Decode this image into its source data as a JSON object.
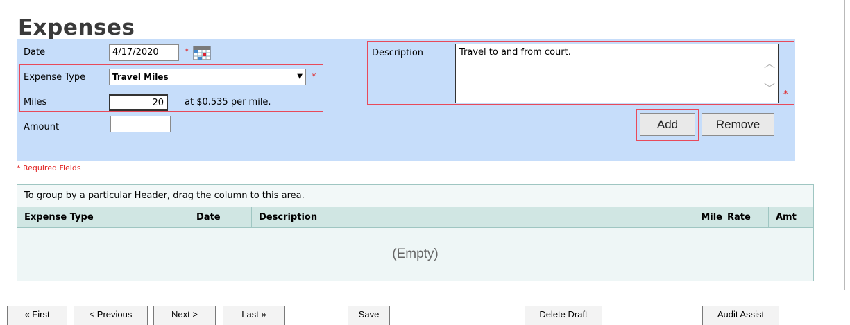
{
  "page": {
    "title": "Expenses"
  },
  "form": {
    "date_label": "Date",
    "date_value": "4/17/2020",
    "required_mark": "*",
    "expense_type_label": "Expense Type",
    "expense_type_value": "Travel Miles",
    "miles_label": "Miles",
    "miles_value": "20",
    "miles_rate_text": "at $0.535 per mile.",
    "amount_label": "Amount",
    "amount_value": "",
    "description_label": "Description",
    "description_value": "Travel to and from court.",
    "add_label": "Add",
    "remove_label": "Remove",
    "required_fields_note": "* Required Fields"
  },
  "grid": {
    "group_hint": "To group by a particular Header, drag the column to this area.",
    "columns": [
      "Expense Type",
      "Date",
      "Description",
      "Mile",
      "Rate",
      "Amt"
    ],
    "empty_text": "(Empty)"
  },
  "nav": {
    "first": "« First",
    "previous": "< Previous",
    "next": "Next >",
    "last": "Last »",
    "save": "Save",
    "delete_draft": "Delete Draft",
    "audit_assist": "Audit Assist"
  },
  "colors": {
    "panel_bg": "#c6ddfa",
    "highlight_border": "#e84a5a",
    "required_star": "#e02020",
    "grid_header_bg": "#d0e6e3"
  }
}
